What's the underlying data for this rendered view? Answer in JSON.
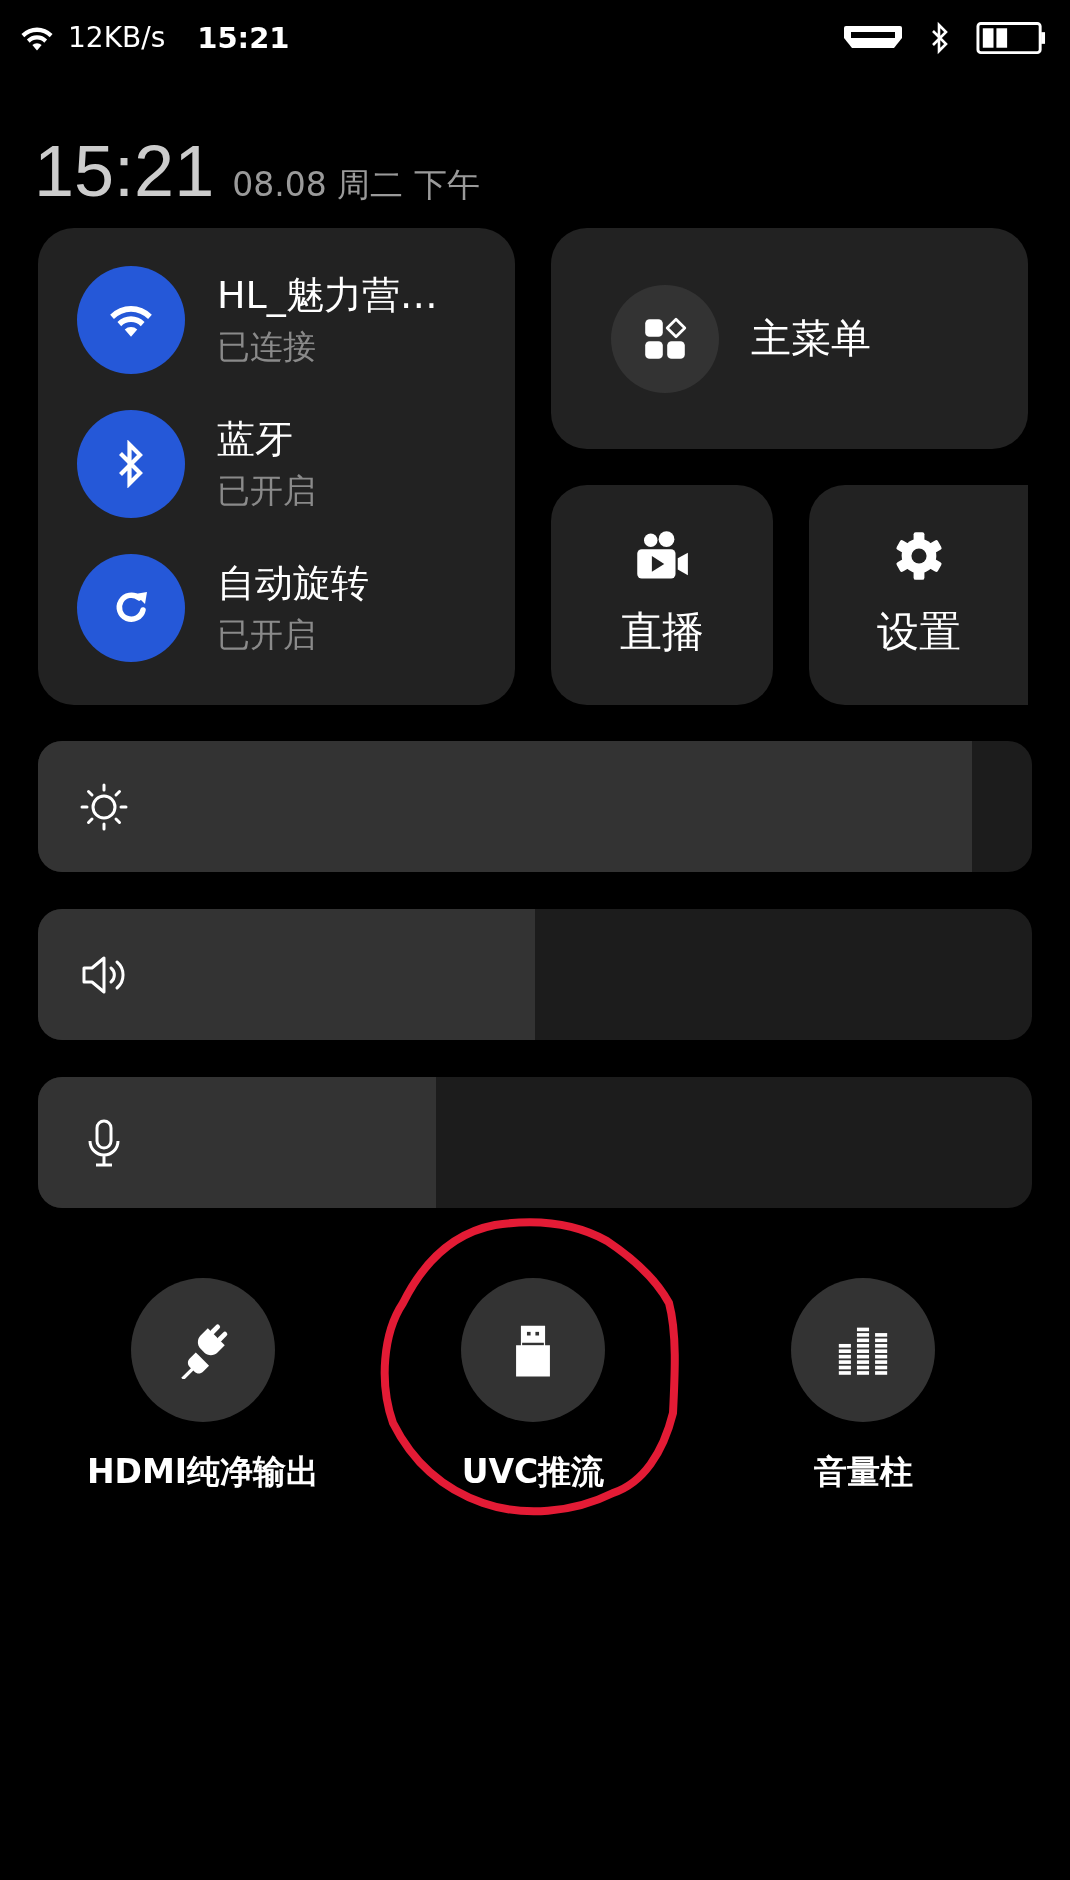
{
  "status_bar": {
    "speed": "12KB/s",
    "time": "15:21"
  },
  "header": {
    "time": "15:21",
    "date": "08.08 周二 下午"
  },
  "toggles": [
    {
      "kind": "wifi",
      "title": "HL_魅力营…",
      "subtitle": "已连接",
      "on": true
    },
    {
      "kind": "bluetooth",
      "title": "蓝牙",
      "subtitle": "已开启",
      "on": true
    },
    {
      "kind": "rotate",
      "title": "自动旋转",
      "subtitle": "已开启",
      "on": true
    }
  ],
  "main_menu": {
    "label": "主菜单"
  },
  "tiles": [
    {
      "kind": "live",
      "label": "直播"
    },
    {
      "kind": "settings",
      "label": "设置"
    }
  ],
  "sliders": [
    {
      "kind": "brightness",
      "level": 0.94
    },
    {
      "kind": "volume",
      "level": 0.5
    },
    {
      "kind": "mic",
      "level": 0.4
    }
  ],
  "shortcuts": [
    {
      "kind": "plug",
      "label": "HDMI纯净输出"
    },
    {
      "kind": "usb",
      "label": "UVC推流"
    },
    {
      "kind": "bars",
      "label": "音量柱"
    }
  ]
}
